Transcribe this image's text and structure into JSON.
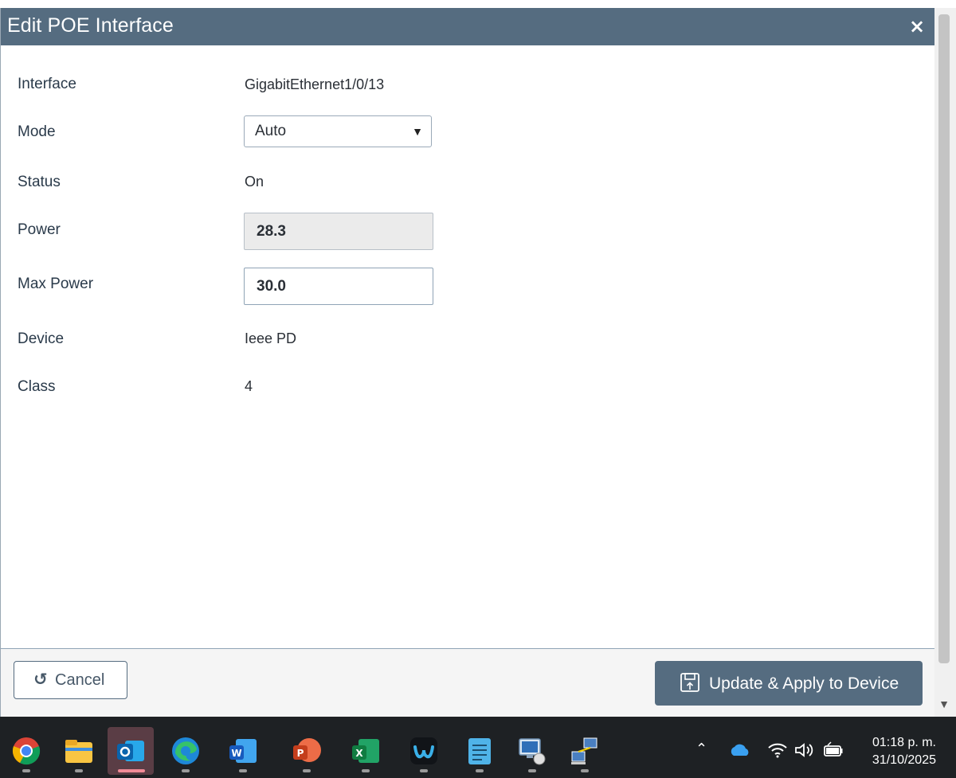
{
  "dialog": {
    "title": "Edit POE Interface",
    "close_glyph": "×",
    "fields": {
      "interface": {
        "label": "Interface",
        "value": "GigabitEthernet1/0/13"
      },
      "mode": {
        "label": "Mode",
        "value": "Auto"
      },
      "status": {
        "label": "Status",
        "value": "On"
      },
      "power": {
        "label": "Power",
        "value": "28.3"
      },
      "max_power": {
        "label": "Max Power",
        "value": "30.0"
      },
      "device": {
        "label": "Device",
        "value": "Ieee PD"
      },
      "class": {
        "label": "Class",
        "value": "4"
      }
    },
    "buttons": {
      "cancel": "Cancel",
      "update": "Update & Apply to Device"
    }
  },
  "taskbar": {
    "apps": [
      "chrome-icon",
      "file-explorer-icon",
      "outlook-icon",
      "edge-icon",
      "word-icon",
      "powerpoint-icon",
      "excel-icon",
      "webex-icon",
      "notepad-icon",
      "remote-desktop-icon",
      "network-icon"
    ],
    "clock": {
      "time": "01:18 p. m.",
      "date": "31/10/2025"
    }
  },
  "colors": {
    "titlebar": "#556c80",
    "button_primary": "#556c80",
    "readonly_field": "#ebebeb",
    "taskbar": "#1e2124"
  }
}
